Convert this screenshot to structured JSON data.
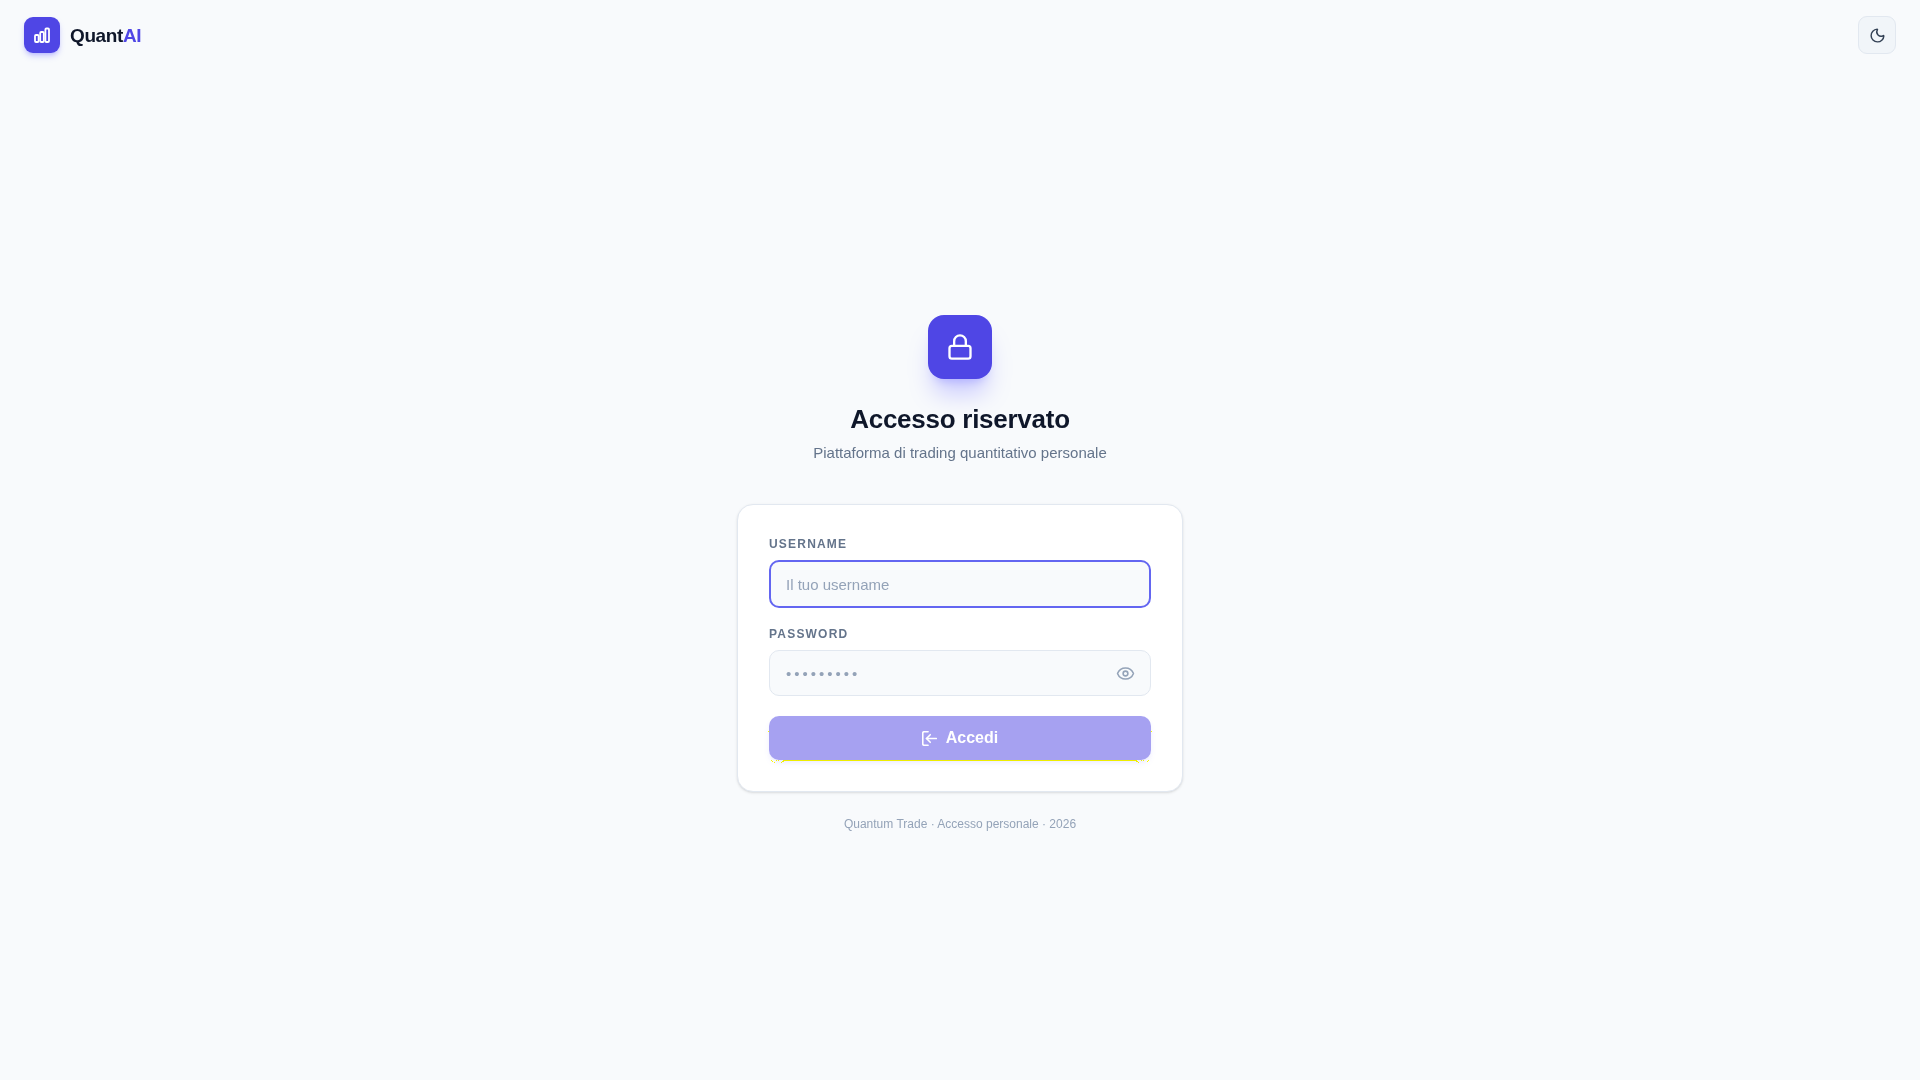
{
  "header": {
    "brand": {
      "name": "Quant",
      "accent": "AI"
    }
  },
  "login": {
    "title": "Accesso riservato",
    "subtitle": "Piattaforma di trading quantitativo personale",
    "fields": [
      {
        "kind": "text",
        "label": "USERNAME",
        "placeholder": "Il tuo username",
        "focused": true
      },
      {
        "kind": "password",
        "label": "PASSWORD",
        "placeholder": "•••••••••",
        "focused": false
      }
    ],
    "submit": {
      "label": "Accedi",
      "disabled": true
    }
  },
  "footer": "Quantum Trade · Accesso personale · 2026"
}
